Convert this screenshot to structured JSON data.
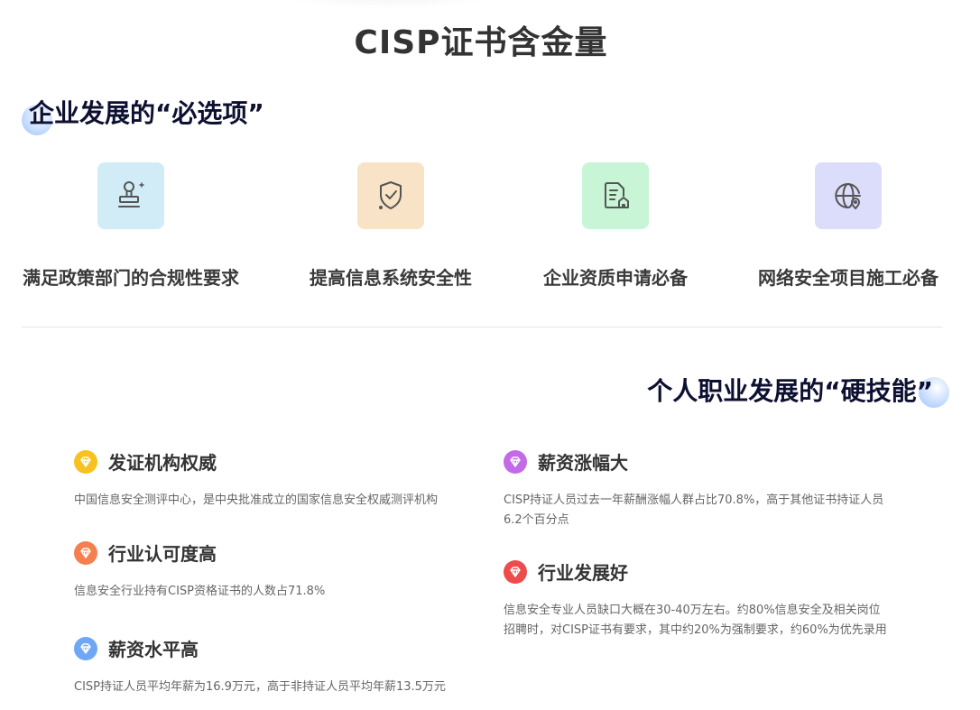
{
  "page_title": "CISP证书含金量",
  "section1": {
    "heading": "企业发展的“必选项”",
    "features": [
      {
        "label": "满足政策部门的合规性要求",
        "icon": "stamp-icon",
        "tile_color": "#d2ecf7"
      },
      {
        "label": "提高信息系统安全性",
        "icon": "shield-check-icon",
        "tile_color": "#f8e3c6"
      },
      {
        "label": "企业资质申请必备",
        "icon": "document-house-icon",
        "tile_color": "#c8f5d6"
      },
      {
        "label": "网络安全项目施工必备",
        "icon": "globe-pin-icon",
        "tile_color": "#dcdcfb"
      }
    ]
  },
  "section2": {
    "heading": "个人职业发展的“硬技能”",
    "items": [
      {
        "title": "发证机构权威",
        "desc": "中国信息安全测评中心，是中央批准成立的国家信息安全权威测评机构",
        "icon": "diamond-icon",
        "color": "#f7c21f"
      },
      {
        "title": "行业认可度高",
        "desc": "信息安全行业持有CISP资格证书的人数占71.8%",
        "icon": "diamond-icon",
        "color": "#f57f4f"
      },
      {
        "title": "薪资水平高",
        "desc": "CISP持证人员平均年薪为16.9万元，高于非持证人员平均年薪13.5万元",
        "icon": "diamond-icon",
        "color": "#6ea7f5"
      },
      {
        "title": "薪资涨幅大",
        "desc": "CISP持证人员过去一年薪酬涨幅人群占比70.8%，高于其他证书持证人员6.2个百分点",
        "icon": "diamond-icon",
        "color": "#c36be6"
      },
      {
        "title": "行业发展好",
        "desc": "信息安全专业人员缺口大概在30-40万左右。约80%信息安全及相关岗位招聘时，对CISP证书有要求，其中约20%为强制要求，约60%为优先录用",
        "icon": "diamond-icon",
        "color": "#ee4c4c"
      }
    ]
  }
}
